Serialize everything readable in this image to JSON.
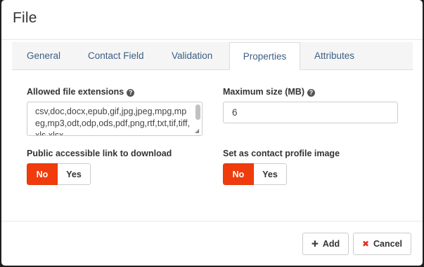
{
  "dialog": {
    "title": "File"
  },
  "tabs": [
    {
      "label": "General"
    },
    {
      "label": "Contact Field"
    },
    {
      "label": "Validation"
    },
    {
      "label": "Properties",
      "active": true
    },
    {
      "label": "Attributes"
    }
  ],
  "fields": {
    "extensions": {
      "label": "Allowed file extensions",
      "value": "csv,doc,docx,epub,gif,jpg,jpeg,mpg,mpeg,mp3,odt,odp,ods,pdf,png,rtf,txt,tif,tiff,xls,xlsx"
    },
    "max_size": {
      "label": "Maximum size (MB)",
      "value": "6"
    },
    "public_link": {
      "label": "Public accessible link to download",
      "no": "No",
      "yes": "Yes",
      "selected": "No"
    },
    "profile_image": {
      "label": "Set as contact profile image",
      "no": "No",
      "yes": "Yes",
      "selected": "No"
    }
  },
  "footer": {
    "add_label": "Add",
    "cancel_label": "Cancel"
  },
  "colors": {
    "accent": "#f03c0c",
    "link": "#3b5e83",
    "cancel_icon": "#e0301e"
  },
  "icons": {
    "help": "question-circle-icon",
    "add": "plus-icon",
    "cancel": "x-icon"
  }
}
